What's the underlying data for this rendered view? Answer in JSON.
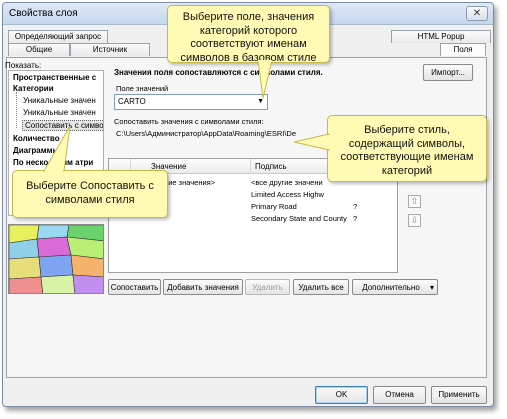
{
  "window": {
    "title": "Свойства слоя",
    "close_glyph": "✕"
  },
  "tabs": [
    {
      "label": "Определяющий запрос"
    },
    {
      "label": "Общие"
    },
    {
      "label": "Источник"
    },
    {
      "label": "HTML Popup"
    },
    {
      "label": "Поля"
    }
  ],
  "show_label": "Показать:",
  "tree": [
    {
      "label": "Пространственные с"
    },
    {
      "label": "Категории"
    },
    {
      "label": "Уникальные значен"
    },
    {
      "label": "Уникальные значен"
    },
    {
      "label": "Сопоставить с символами стиля"
    },
    {
      "label": "Количество"
    },
    {
      "label": "Диаграммы"
    },
    {
      "label": "По нескольким атри"
    }
  ],
  "main": {
    "heading": "Значения поля сопоставляются с символами стиля.",
    "import_button": "Импорт...",
    "value_field_label": "Поле значений",
    "value_field_value": "CARTO",
    "style_label": "Сопоставить значения с символами стиля:",
    "style_path": "C:\\Users\\Администратор\\AppData\\Roaming\\ESRI\\De"
  },
  "table": {
    "columns": [
      "Значение",
      "Подпись"
    ],
    "rows": [
      {
        "value": "<все другие значения>",
        "label": "<все другие значени"
      },
      {
        "value": "",
        "label": "Limited Access Highw"
      },
      {
        "value": "",
        "label": "Primary Road"
      },
      {
        "value": "",
        "label": "Secondary State and County"
      }
    ],
    "marks": [
      "?",
      "?"
    ]
  },
  "side_buttons": {
    "up": "⇧",
    "down": "⇩"
  },
  "bottom_buttons": {
    "match": "Сопоставить",
    "add_values": "Добавить значения",
    "remove": "Удалить",
    "remove_all": "Удалить все",
    "advanced": "Дополнительно"
  },
  "dialog_buttons": {
    "ok": "OK",
    "cancel": "Отмена",
    "apply": "Применить"
  },
  "callouts": {
    "field": "Выберите поле, значения категорий которого соответствуют именам символов в базовом стиле",
    "style": "Выберите стиль, содержащий символы, соответствующие именам категорий",
    "match": "Выберите Сопоставить с символами стиля"
  },
  "colors": {
    "callout_bg": "#fffbb5",
    "callout_border": "#c8b84a",
    "titlebar": "#c4d6ee"
  }
}
